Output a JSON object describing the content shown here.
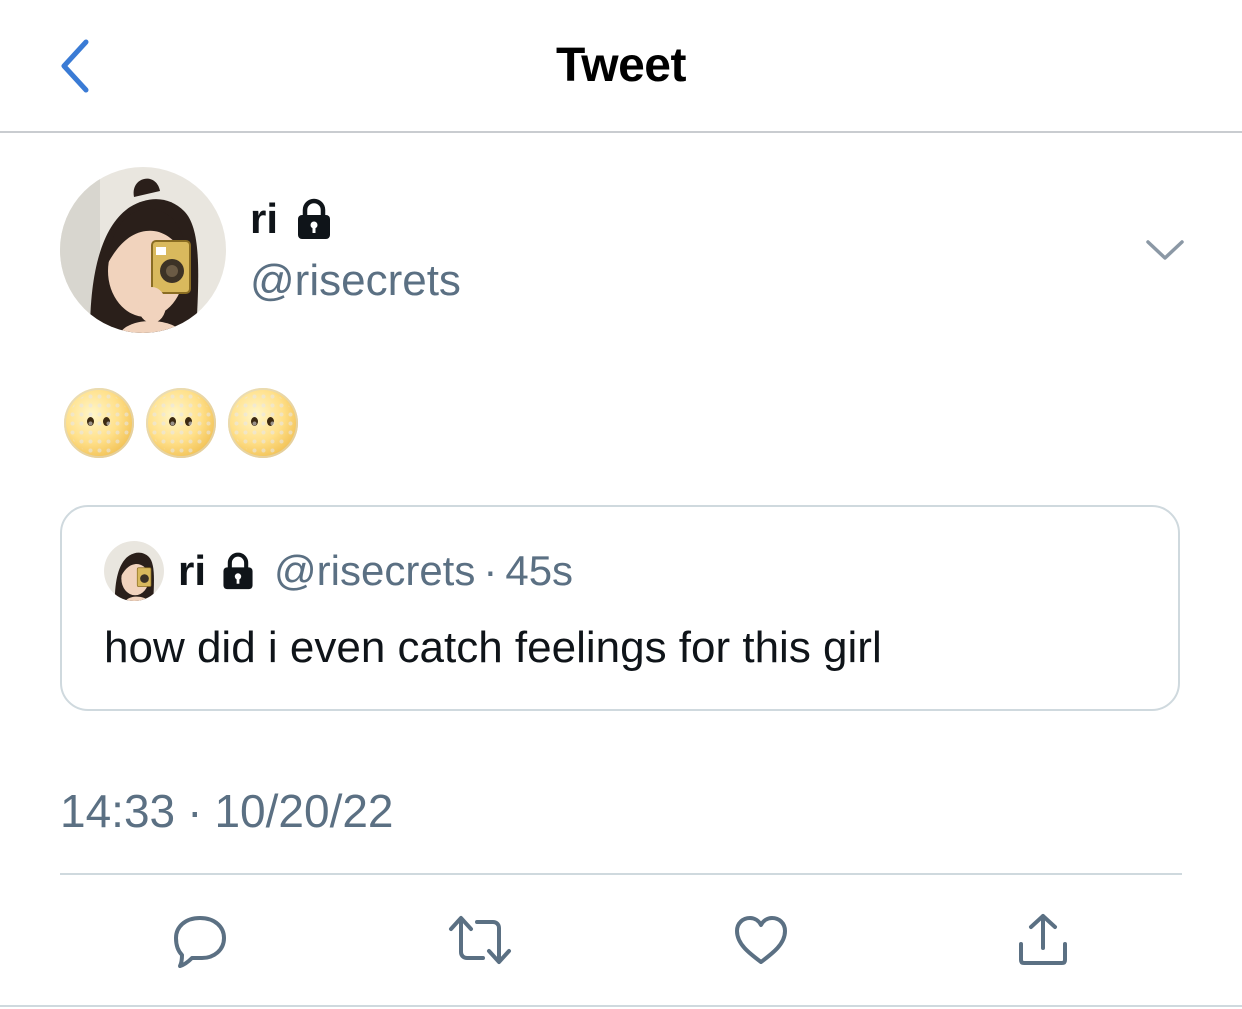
{
  "header": {
    "title": "Tweet",
    "back_icon": "chevron-left-icon",
    "back_color": "#3a7bd5"
  },
  "tweet": {
    "author": {
      "name": "ri",
      "handle": "@risecrets",
      "lock_icon": "lock-icon",
      "avatar": "avatar"
    },
    "emojis": [
      "face-without-mouth-emoji",
      "face-without-mouth-emoji",
      "face-without-mouth-emoji"
    ],
    "quoted": {
      "name": "ri",
      "handle": "@risecrets",
      "separator": "·",
      "time": "45s",
      "text": "how did i even catch feelings for this girl"
    },
    "timestamp": {
      "time": "14:33",
      "separator": "·",
      "date": "10/20/22"
    }
  },
  "actions": [
    {
      "icon": "reply-icon"
    },
    {
      "icon": "retweet-icon"
    },
    {
      "icon": "like-icon"
    },
    {
      "icon": "share-icon"
    }
  ],
  "colors": {
    "text_primary": "#0f1419",
    "text_secondary": "#5b7083",
    "border": "#cfd9de",
    "accent": "#3a7bd5"
  }
}
